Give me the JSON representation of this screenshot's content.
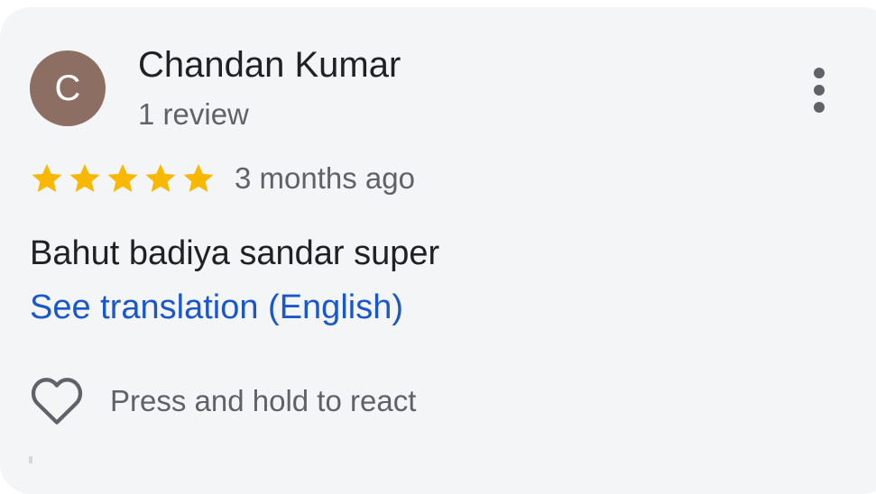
{
  "review": {
    "author": {
      "initial": "C",
      "name": "Chandan Kumar",
      "review_count": "1 review"
    },
    "rating": 5,
    "max_rating": 5,
    "time_ago": "3 months ago",
    "text": "Bahut badiya sandar super",
    "translation_link": "See translation (English)",
    "react_prompt": "Press and hold to react"
  },
  "icons": {
    "avatar": "avatar-initial",
    "more": "more-vertical-icon",
    "star": "star-icon",
    "heart": "heart-outline-icon"
  },
  "colors": {
    "card_background": "#f4f5f7",
    "avatar_background": "#8d6e63",
    "star": "#f9b800",
    "link": "#1a57c9",
    "primary_text": "#202124",
    "secondary_text": "#5f6368"
  }
}
